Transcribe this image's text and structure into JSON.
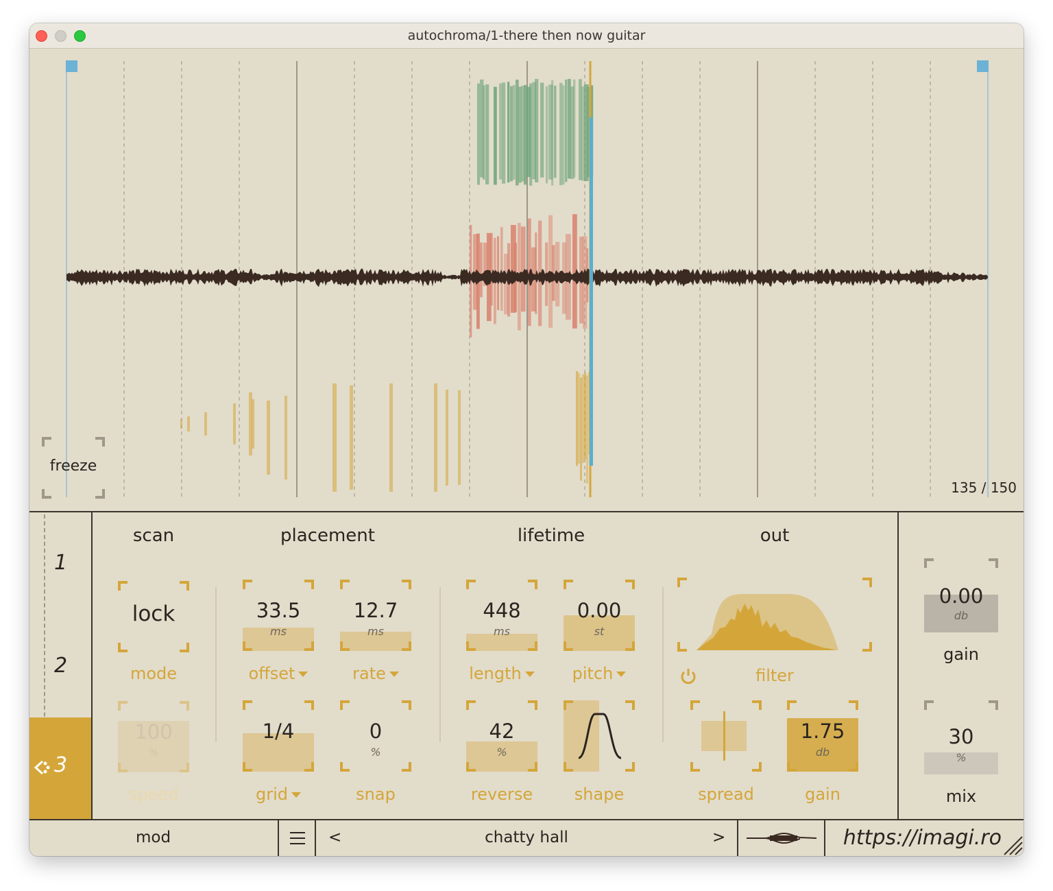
{
  "window": {
    "title": "autochroma/1-there then now guitar"
  },
  "viewer": {
    "freeze_label": "freeze",
    "counter_current": "135",
    "counter_sep": "/",
    "counter_total": "150",
    "colors": {
      "waveform": "#3a2a22",
      "green": "#6fa47a",
      "red": "#d9826e",
      "yellow": "#d4a63a",
      "playhead": "#5aaed0",
      "marker": "#6cb2d4"
    }
  },
  "slots": [
    {
      "label": "1"
    },
    {
      "label": "2"
    },
    {
      "label": "3",
      "active": true
    }
  ],
  "sections": {
    "scan": "scan",
    "placement": "placement",
    "lifetime": "lifetime",
    "out": "out"
  },
  "scan": {
    "mode": {
      "value": "lock",
      "label": "mode"
    },
    "speed": {
      "value": "100",
      "unit": "%",
      "label": "speed",
      "fill": 0.72
    }
  },
  "placement": {
    "offset": {
      "value": "33.5",
      "unit": "ms",
      "label": "offset",
      "fill": 0.33
    },
    "rate": {
      "value": "12.7",
      "unit": "ms",
      "label": "rate",
      "fill": 0.27
    },
    "grid": {
      "value": "1/4",
      "label": "grid",
      "fill": 0.54
    },
    "snap": {
      "value": "0",
      "unit": "%",
      "label": "snap",
      "fill": 0.0
    }
  },
  "lifetime": {
    "length": {
      "value": "448",
      "unit": "ms",
      "label": "length",
      "fill": 0.24
    },
    "pitch": {
      "value": "0.00",
      "unit": "st",
      "label": "pitch",
      "fill": 0.5
    },
    "reverse": {
      "value": "42",
      "unit": "%",
      "label": "reverse",
      "fill": 0.42
    },
    "shape": {
      "label": "shape"
    }
  },
  "out": {
    "filter": {
      "label": "filter"
    },
    "spread": {
      "label": "spread"
    },
    "gain": {
      "value": "1.75",
      "unit": "db",
      "label": "gain",
      "fill": 0.75
    }
  },
  "master": {
    "gain": {
      "value": "0.00",
      "unit": "db",
      "label": "gain",
      "fill": 0.5
    },
    "mix": {
      "value": "30",
      "unit": "%",
      "label": "mix",
      "fill": 0.3
    }
  },
  "footer": {
    "mod_label": "mod",
    "prev": "<",
    "preset": "chatty hall",
    "next": ">",
    "url": "https://imagi.ro"
  },
  "icons": [
    "menu-icon",
    "power-icon",
    "waveform-thumb-icon",
    "resize-grip-icon",
    "mod-arrow-icon"
  ]
}
